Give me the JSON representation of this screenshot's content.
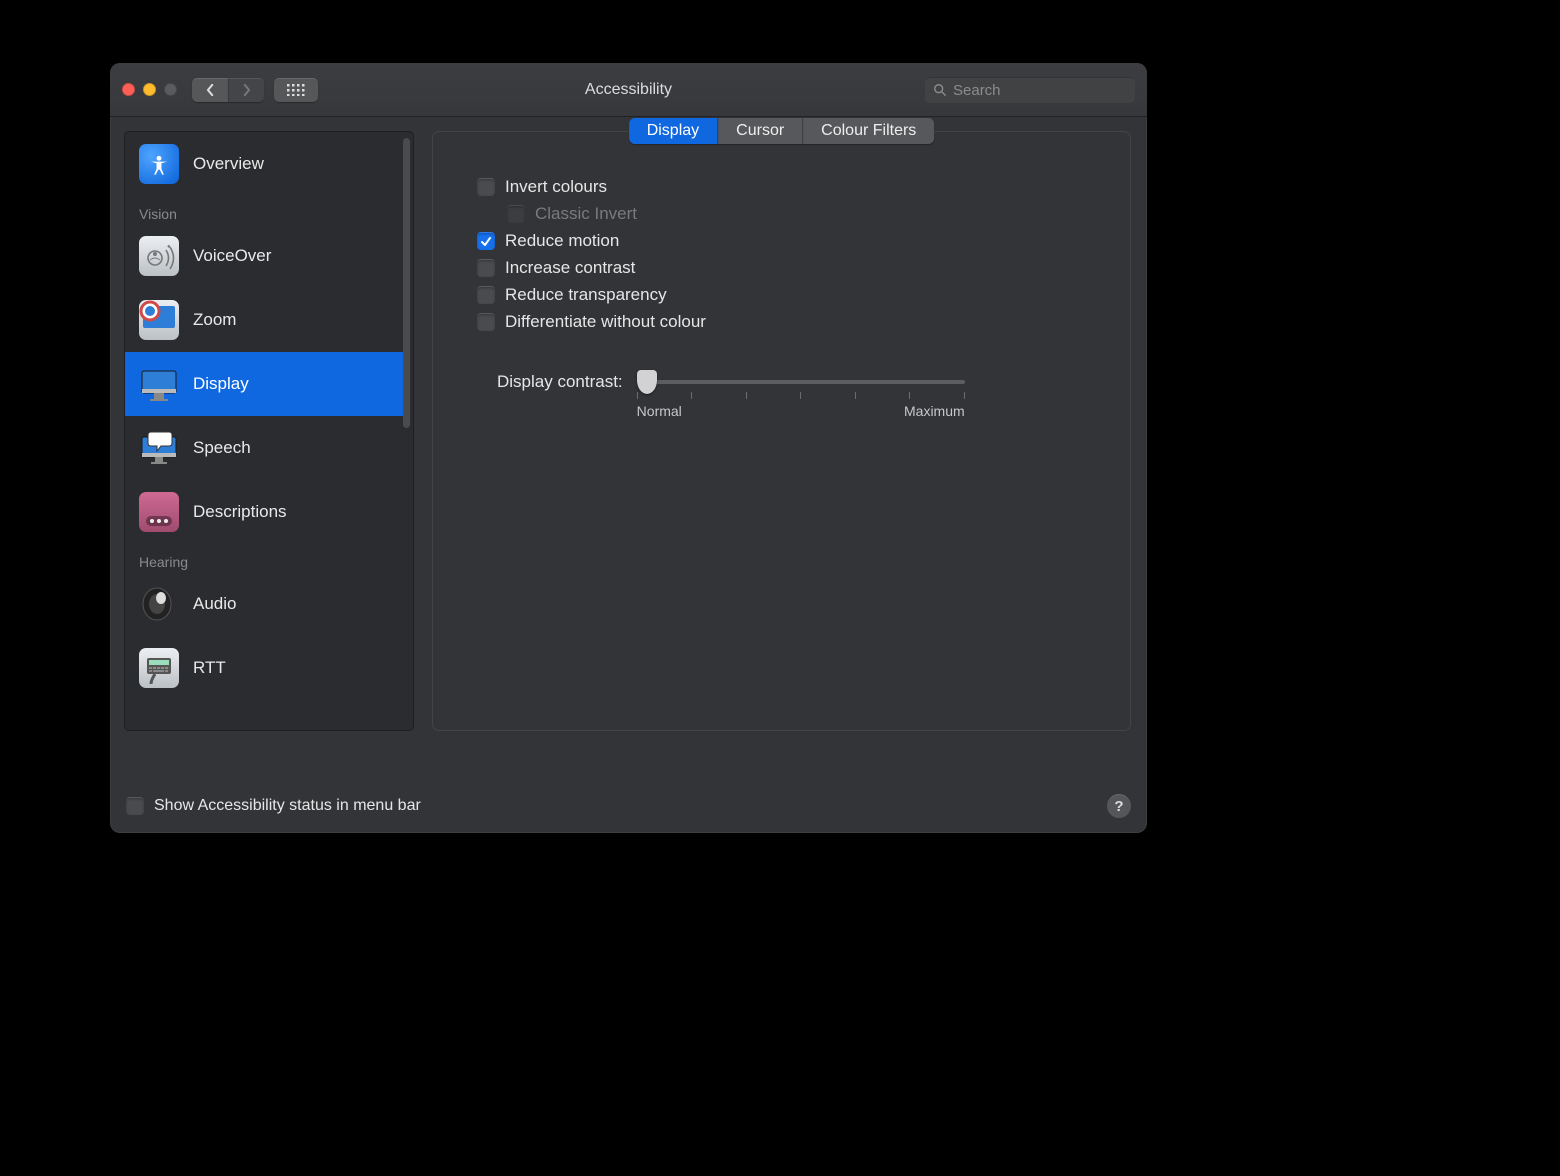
{
  "window": {
    "title": "Accessibility"
  },
  "search": {
    "placeholder": "Search"
  },
  "sidebar": {
    "items": [
      {
        "label": "Overview"
      },
      {
        "label": "VoiceOver"
      },
      {
        "label": "Zoom"
      },
      {
        "label": "Display"
      },
      {
        "label": "Speech"
      },
      {
        "label": "Descriptions"
      },
      {
        "label": "Audio"
      },
      {
        "label": "RTT"
      }
    ],
    "groups": {
      "vision": "Vision",
      "hearing": "Hearing"
    }
  },
  "tabs": {
    "display": "Display",
    "cursor": "Cursor",
    "colour_filters": "Colour Filters"
  },
  "options": {
    "invert_colours": {
      "label": "Invert colours",
      "checked": false
    },
    "classic_invert": {
      "label": "Classic Invert",
      "checked": false,
      "disabled": true
    },
    "reduce_motion": {
      "label": "Reduce motion",
      "checked": true
    },
    "increase_contrast": {
      "label": "Increase contrast",
      "checked": false
    },
    "reduce_transparency": {
      "label": "Reduce transparency",
      "checked": false
    },
    "differentiate_without_colour": {
      "label": "Differentiate without colour",
      "checked": false
    }
  },
  "slider": {
    "label": "Display contrast:",
    "min_label": "Normal",
    "max_label": "Maximum",
    "value": 0
  },
  "footer": {
    "show_status_label": "Show Accessibility status in menu bar",
    "show_status_checked": false,
    "help": "?"
  }
}
